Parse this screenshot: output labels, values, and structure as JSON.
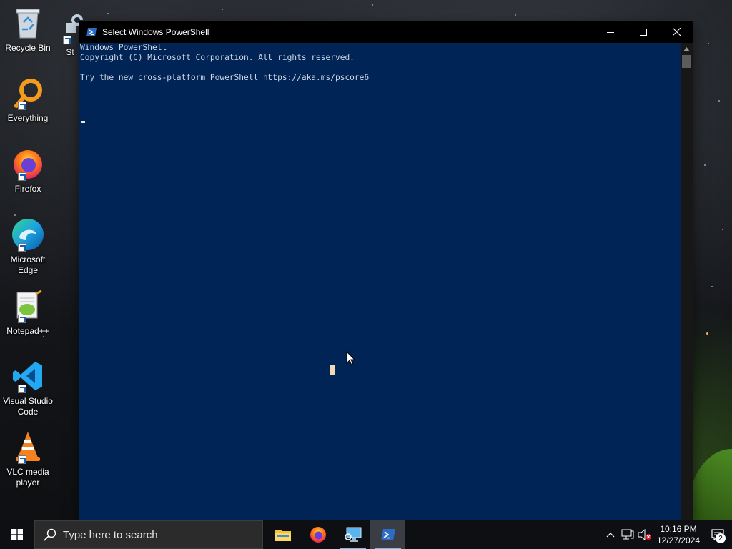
{
  "desktop": {
    "icons": [
      {
        "label": "Recycle Bin",
        "icon": "recycle-bin-icon"
      },
      {
        "label": "St",
        "icon": "steam-icon"
      },
      {
        "label": "Everything",
        "icon": "everything-search-icon"
      },
      {
        "label": "Firefox",
        "icon": "firefox-icon"
      },
      {
        "label": "Microsoft\nEdge",
        "icon": "edge-icon"
      },
      {
        "label": "Notepad++",
        "icon": "notepadpp-icon"
      },
      {
        "label": "Visual Studio\nCode",
        "icon": "vscode-icon"
      },
      {
        "label": "VLC media\nplayer",
        "icon": "vlc-icon"
      }
    ]
  },
  "window": {
    "title": "Select Windows PowerShell",
    "console_lines": [
      "Windows PowerShell",
      "Copyright (C) Microsoft Corporation. All rights reserved.",
      "",
      "Try the new cross-platform PowerShell https://aka.ms/pscore6"
    ],
    "background_color": "#012456"
  },
  "taskbar": {
    "search_placeholder": "Type here to search",
    "apps": [
      {
        "name": "File Explorer",
        "icon": "file-explorer-icon"
      },
      {
        "name": "Firefox",
        "icon": "firefox-icon"
      },
      {
        "name": "Remote Desktop",
        "icon": "remote-desktop-icon"
      },
      {
        "name": "Windows PowerShell",
        "icon": "powershell-icon",
        "active": true
      }
    ],
    "clock": {
      "time": "10:16 PM",
      "date": "12/27/2024"
    },
    "notification_count": "2"
  }
}
